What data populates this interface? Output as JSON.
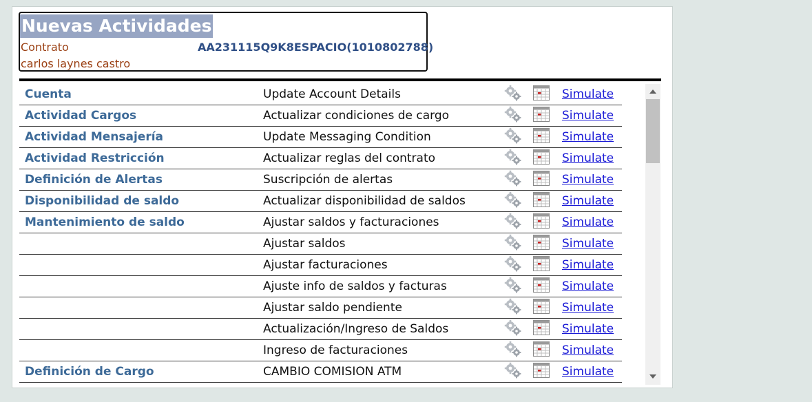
{
  "header": {
    "title": "Nuevas Actividades",
    "contract_label": "Contrato",
    "contract_id": "AA231115Q9K8ESPACIO(1010802788)",
    "customer_name": "carlos laynes castro"
  },
  "rows": [
    {
      "category": "Cuenta",
      "activity": "Update Account Details",
      "action": "Simulate"
    },
    {
      "category": "Actividad Cargos",
      "activity": "Actualizar condiciones de cargo",
      "action": "Simulate"
    },
    {
      "category": "Actividad Mensajería",
      "activity": "Update Messaging Condition",
      "action": "Simulate"
    },
    {
      "category": "Actividad Restricción",
      "activity": "Actualizar reglas del contrato",
      "action": "Simulate"
    },
    {
      "category": "Definición de Alertas",
      "activity": "Suscripción de alertas",
      "action": "Simulate"
    },
    {
      "category": "Disponibilidad de saldo",
      "activity": "Actualizar disponibilidad de saldos",
      "action": "Simulate"
    },
    {
      "category": "Mantenimiento de saldo",
      "activity": "Ajustar saldos y facturaciones",
      "action": "Simulate"
    },
    {
      "category": "",
      "activity": "Ajustar saldos",
      "action": "Simulate"
    },
    {
      "category": "",
      "activity": "Ajustar facturaciones",
      "action": "Simulate"
    },
    {
      "category": "",
      "activity": "Ajuste info de saldos y facturas",
      "action": "Simulate"
    },
    {
      "category": "",
      "activity": "Ajustar saldo pendiente",
      "action": "Simulate"
    },
    {
      "category": "",
      "activity": "Actualización/Ingreso de Saldos",
      "action": "Simulate"
    },
    {
      "category": "",
      "activity": "Ingreso de facturaciones",
      "action": "Simulate"
    },
    {
      "category": "Definición de Cargo",
      "activity": "CAMBIO COMISION ATM",
      "action": "Simulate"
    }
  ],
  "icons": {
    "settings": "gears-icon",
    "schedule": "calendar-icon"
  },
  "colors": {
    "title_bg": "#97a5c3",
    "category_text": "#3d6a98",
    "contract_label": "#9a3f12",
    "link": "#1a1ad6"
  }
}
